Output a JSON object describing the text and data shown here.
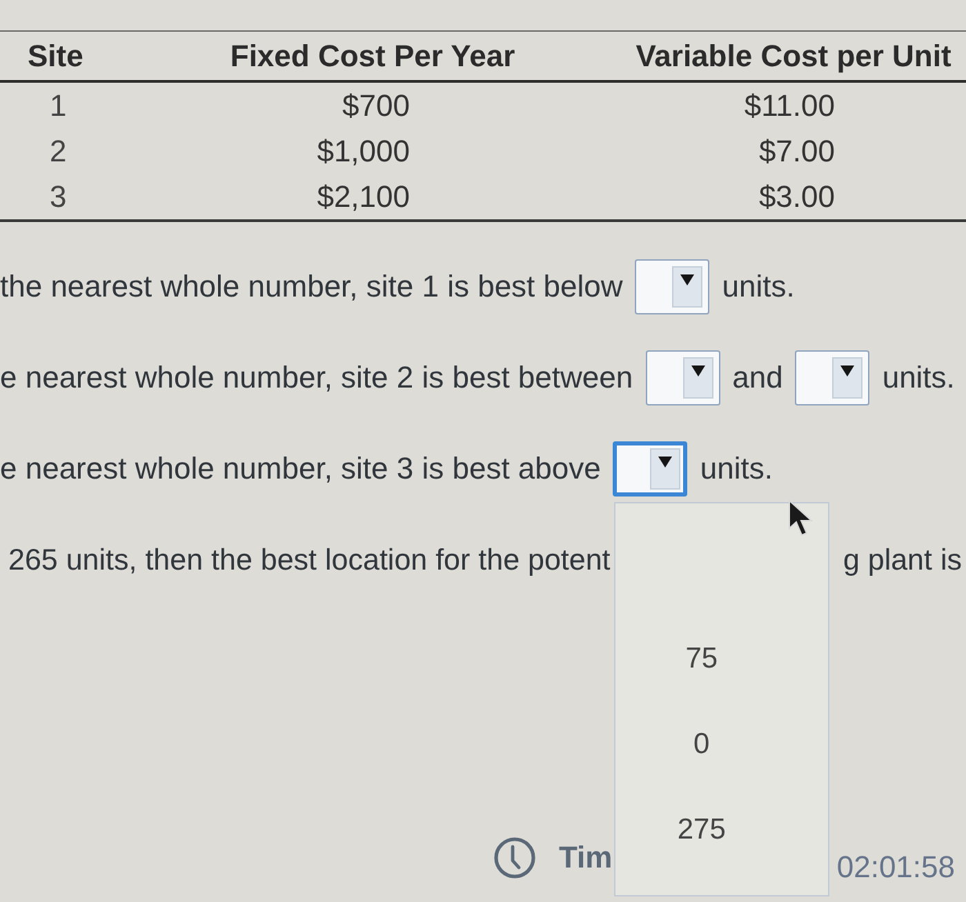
{
  "table": {
    "columns": [
      "Site",
      "Fixed Cost Per Year",
      "Variable Cost per Unit"
    ],
    "rows": [
      [
        "1",
        "$700",
        "$11.00"
      ],
      [
        "2",
        "$1,000",
        "$7.00"
      ],
      [
        "3",
        "$2,100",
        "$3.00"
      ]
    ]
  },
  "questions": [
    {
      "parts": [
        {
          "kind": "text",
          "text": "the nearest whole number, site 1 is best below"
        },
        {
          "kind": "dropdown",
          "open": false
        },
        {
          "kind": "text",
          "text": "units."
        }
      ]
    },
    {
      "parts": [
        {
          "kind": "text",
          "text": "e nearest whole number, site 2 is best between"
        },
        {
          "kind": "dropdown",
          "open": false
        },
        {
          "kind": "text",
          "text": "and"
        },
        {
          "kind": "dropdown",
          "open": false
        },
        {
          "kind": "text",
          "text": "units."
        }
      ]
    },
    {
      "parts": [
        {
          "kind": "text",
          "text": "e nearest whole number, site 3 is best above"
        },
        {
          "kind": "dropdown",
          "open": true,
          "options": [
            {
              "label": "75",
              "selected": false
            },
            {
              "label": "0",
              "selected": false
            },
            {
              "label": "275",
              "selected": false
            }
          ]
        },
        {
          "kind": "text",
          "text": "units."
        }
      ]
    }
  ],
  "statement": {
    "before": "265 units, then the best location for the potent",
    "after": "g plant is"
  },
  "timer": {
    "label": "Tim",
    "time": "02:01:58"
  }
}
